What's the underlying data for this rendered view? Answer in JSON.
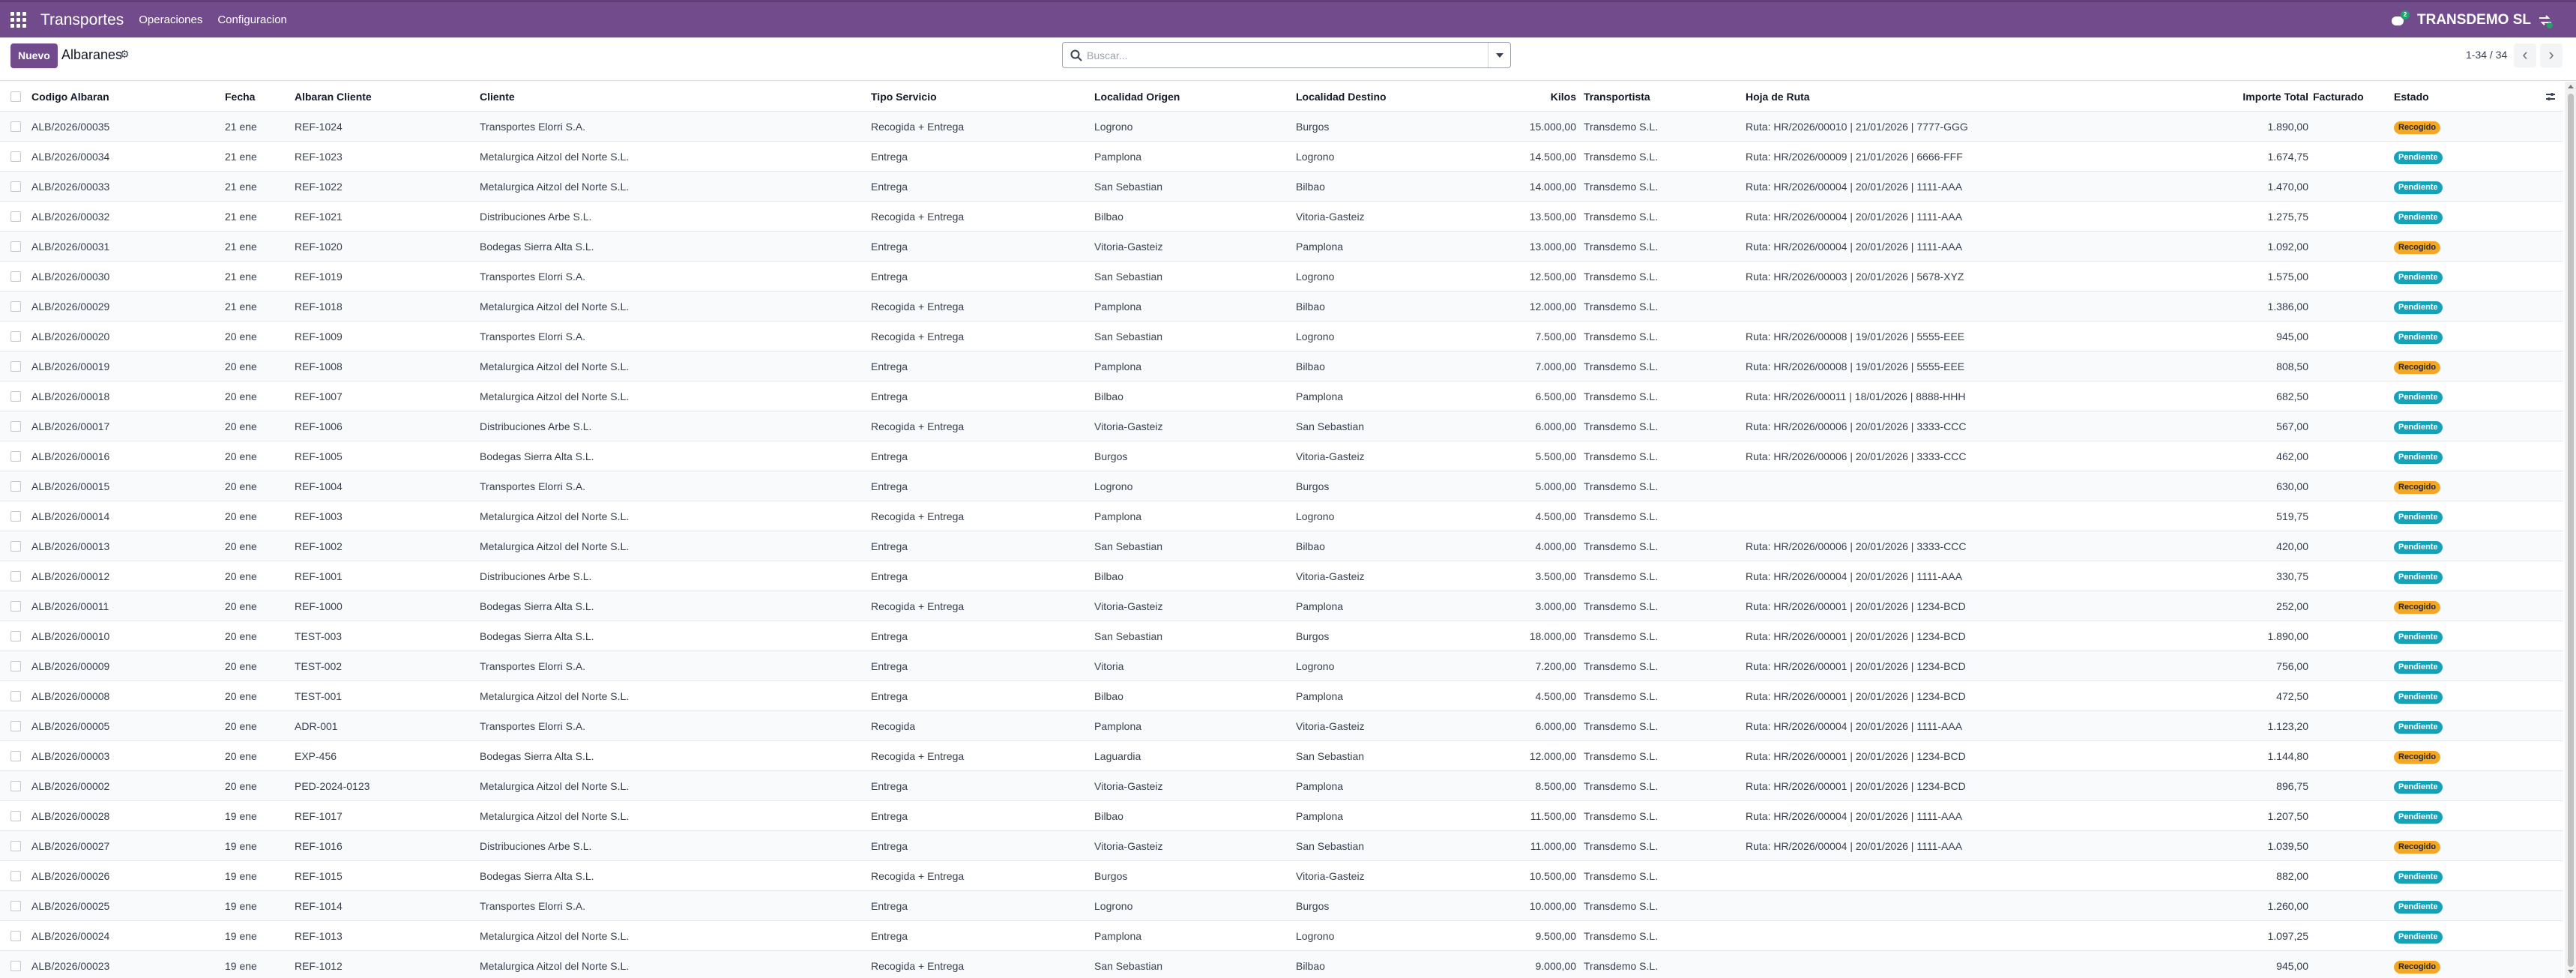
{
  "navbar": {
    "app_title": "Transportes",
    "menu": [
      "Operaciones",
      "Configuracion"
    ],
    "chat_badge": "2",
    "company": "TRANSDEMO SL"
  },
  "control": {
    "new_label": "Nuevo",
    "breadcrumb": "Albaranes",
    "search_placeholder": "Buscar...",
    "pager": "1-34 / 34"
  },
  "columns": [
    "Codigo Albaran",
    "Fecha",
    "Albaran Cliente",
    "Cliente",
    "Tipo Servicio",
    "Localidad Origen",
    "Localidad Destino",
    "Kilos",
    "Transportista",
    "Hoja de Ruta",
    "Importe Total",
    "Facturado",
    "Estado"
  ],
  "rows": [
    [
      "ALB/2026/00035",
      "21 ene",
      "REF-1024",
      "Transportes Elorri S.A.",
      "Recogida + Entrega",
      "Logrono",
      "Burgos",
      "15.000,00",
      "Transdemo S.L.",
      "Ruta: HR/2026/00010 | 21/01/2026 | 7777-GGG",
      "1.890,00",
      "",
      "Recogido"
    ],
    [
      "ALB/2026/00034",
      "21 ene",
      "REF-1023",
      "Metalurgica Aitzol del Norte S.L.",
      "Entrega",
      "Pamplona",
      "Logrono",
      "14.500,00",
      "Transdemo S.L.",
      "Ruta: HR/2026/00009 | 21/01/2026 | 6666-FFF",
      "1.674,75",
      "",
      "Pendiente"
    ],
    [
      "ALB/2026/00033",
      "21 ene",
      "REF-1022",
      "Metalurgica Aitzol del Norte S.L.",
      "Entrega",
      "San Sebastian",
      "Bilbao",
      "14.000,00",
      "Transdemo S.L.",
      "Ruta: HR/2026/00004 | 20/01/2026 | 1111-AAA",
      "1.470,00",
      "",
      "Pendiente"
    ],
    [
      "ALB/2026/00032",
      "21 ene",
      "REF-1021",
      "Distribuciones Arbe S.L.",
      "Recogida + Entrega",
      "Bilbao",
      "Vitoria-Gasteiz",
      "13.500,00",
      "Transdemo S.L.",
      "Ruta: HR/2026/00004 | 20/01/2026 | 1111-AAA",
      "1.275,75",
      "",
      "Pendiente"
    ],
    [
      "ALB/2026/00031",
      "21 ene",
      "REF-1020",
      "Bodegas Sierra Alta S.L.",
      "Entrega",
      "Vitoria-Gasteiz",
      "Pamplona",
      "13.000,00",
      "Transdemo S.L.",
      "Ruta: HR/2026/00004 | 20/01/2026 | 1111-AAA",
      "1.092,00",
      "",
      "Recogido"
    ],
    [
      "ALB/2026/00030",
      "21 ene",
      "REF-1019",
      "Transportes Elorri S.A.",
      "Entrega",
      "San Sebastian",
      "Logrono",
      "12.500,00",
      "Transdemo S.L.",
      "Ruta: HR/2026/00003 | 20/01/2026 | 5678-XYZ",
      "1.575,00",
      "",
      "Pendiente"
    ],
    [
      "ALB/2026/00029",
      "21 ene",
      "REF-1018",
      "Metalurgica Aitzol del Norte S.L.",
      "Recogida + Entrega",
      "Pamplona",
      "Bilbao",
      "12.000,00",
      "Transdemo S.L.",
      "",
      "1.386,00",
      "",
      "Pendiente"
    ],
    [
      "ALB/2026/00020",
      "20 ene",
      "REF-1009",
      "Transportes Elorri S.A.",
      "Recogida + Entrega",
      "San Sebastian",
      "Logrono",
      "7.500,00",
      "Transdemo S.L.",
      "Ruta: HR/2026/00008 | 19/01/2026 | 5555-EEE",
      "945,00",
      "",
      "Pendiente"
    ],
    [
      "ALB/2026/00019",
      "20 ene",
      "REF-1008",
      "Metalurgica Aitzol del Norte S.L.",
      "Entrega",
      "Pamplona",
      "Bilbao",
      "7.000,00",
      "Transdemo S.L.",
      "Ruta: HR/2026/00008 | 19/01/2026 | 5555-EEE",
      "808,50",
      "",
      "Recogido"
    ],
    [
      "ALB/2026/00018",
      "20 ene",
      "REF-1007",
      "Metalurgica Aitzol del Norte S.L.",
      "Entrega",
      "Bilbao",
      "Pamplona",
      "6.500,00",
      "Transdemo S.L.",
      "Ruta: HR/2026/00011 | 18/01/2026 | 8888-HHH",
      "682,50",
      "",
      "Pendiente"
    ],
    [
      "ALB/2026/00017",
      "20 ene",
      "REF-1006",
      "Distribuciones Arbe S.L.",
      "Recogida + Entrega",
      "Vitoria-Gasteiz",
      "San Sebastian",
      "6.000,00",
      "Transdemo S.L.",
      "Ruta: HR/2026/00006 | 20/01/2026 | 3333-CCC",
      "567,00",
      "",
      "Pendiente"
    ],
    [
      "ALB/2026/00016",
      "20 ene",
      "REF-1005",
      "Bodegas Sierra Alta S.L.",
      "Entrega",
      "Burgos",
      "Vitoria-Gasteiz",
      "5.500,00",
      "Transdemo S.L.",
      "Ruta: HR/2026/00006 | 20/01/2026 | 3333-CCC",
      "462,00",
      "",
      "Pendiente"
    ],
    [
      "ALB/2026/00015",
      "20 ene",
      "REF-1004",
      "Transportes Elorri S.A.",
      "Entrega",
      "Logrono",
      "Burgos",
      "5.000,00",
      "Transdemo S.L.",
      "",
      "630,00",
      "",
      "Recogido"
    ],
    [
      "ALB/2026/00014",
      "20 ene",
      "REF-1003",
      "Metalurgica Aitzol del Norte S.L.",
      "Recogida + Entrega",
      "Pamplona",
      "Logrono",
      "4.500,00",
      "Transdemo S.L.",
      "",
      "519,75",
      "",
      "Pendiente"
    ],
    [
      "ALB/2026/00013",
      "20 ene",
      "REF-1002",
      "Metalurgica Aitzol del Norte S.L.",
      "Entrega",
      "San Sebastian",
      "Bilbao",
      "4.000,00",
      "Transdemo S.L.",
      "Ruta: HR/2026/00006 | 20/01/2026 | 3333-CCC",
      "420,00",
      "",
      "Pendiente"
    ],
    [
      "ALB/2026/00012",
      "20 ene",
      "REF-1001",
      "Distribuciones Arbe S.L.",
      "Entrega",
      "Bilbao",
      "Vitoria-Gasteiz",
      "3.500,00",
      "Transdemo S.L.",
      "Ruta: HR/2026/00004 | 20/01/2026 | 1111-AAA",
      "330,75",
      "",
      "Pendiente"
    ],
    [
      "ALB/2026/00011",
      "20 ene",
      "REF-1000",
      "Bodegas Sierra Alta S.L.",
      "Recogida + Entrega",
      "Vitoria-Gasteiz",
      "Pamplona",
      "3.000,00",
      "Transdemo S.L.",
      "Ruta: HR/2026/00001 | 20/01/2026 | 1234-BCD",
      "252,00",
      "",
      "Recogido"
    ],
    [
      "ALB/2026/00010",
      "20 ene",
      "TEST-003",
      "Bodegas Sierra Alta S.L.",
      "Entrega",
      "San Sebastian",
      "Burgos",
      "18.000,00",
      "Transdemo S.L.",
      "Ruta: HR/2026/00001 | 20/01/2026 | 1234-BCD",
      "1.890,00",
      "",
      "Pendiente"
    ],
    [
      "ALB/2026/00009",
      "20 ene",
      "TEST-002",
      "Transportes Elorri S.A.",
      "Entrega",
      "Vitoria",
      "Logrono",
      "7.200,00",
      "Transdemo S.L.",
      "Ruta: HR/2026/00001 | 20/01/2026 | 1234-BCD",
      "756,00",
      "",
      "Pendiente"
    ],
    [
      "ALB/2026/00008",
      "20 ene",
      "TEST-001",
      "Metalurgica Aitzol del Norte S.L.",
      "Entrega",
      "Bilbao",
      "Pamplona",
      "4.500,00",
      "Transdemo S.L.",
      "Ruta: HR/2026/00001 | 20/01/2026 | 1234-BCD",
      "472,50",
      "",
      "Pendiente"
    ],
    [
      "ALB/2026/00005",
      "20 ene",
      "ADR-001",
      "Transportes Elorri S.A.",
      "Recogida",
      "Pamplona",
      "Vitoria-Gasteiz",
      "6.000,00",
      "Transdemo S.L.",
      "Ruta: HR/2026/00004 | 20/01/2026 | 1111-AAA",
      "1.123,20",
      "",
      "Pendiente"
    ],
    [
      "ALB/2026/00003",
      "20 ene",
      "EXP-456",
      "Bodegas Sierra Alta S.L.",
      "Recogida + Entrega",
      "Laguardia",
      "San Sebastian",
      "12.000,00",
      "Transdemo S.L.",
      "Ruta: HR/2026/00001 | 20/01/2026 | 1234-BCD",
      "1.144,80",
      "",
      "Recogido"
    ],
    [
      "ALB/2026/00002",
      "20 ene",
      "PED-2024-0123",
      "Metalurgica Aitzol del Norte S.L.",
      "Entrega",
      "Vitoria-Gasteiz",
      "Pamplona",
      "8.500,00",
      "Transdemo S.L.",
      "Ruta: HR/2026/00001 | 20/01/2026 | 1234-BCD",
      "896,75",
      "",
      "Pendiente"
    ],
    [
      "ALB/2026/00028",
      "19 ene",
      "REF-1017",
      "Metalurgica Aitzol del Norte S.L.",
      "Entrega",
      "Bilbao",
      "Pamplona",
      "11.500,00",
      "Transdemo S.L.",
      "Ruta: HR/2026/00004 | 20/01/2026 | 1111-AAA",
      "1.207,50",
      "",
      "Pendiente"
    ],
    [
      "ALB/2026/00027",
      "19 ene",
      "REF-1016",
      "Distribuciones Arbe S.L.",
      "Entrega",
      "Vitoria-Gasteiz",
      "San Sebastian",
      "11.000,00",
      "Transdemo S.L.",
      "Ruta: HR/2026/00004 | 20/01/2026 | 1111-AAA",
      "1.039,50",
      "",
      "Recogido"
    ],
    [
      "ALB/2026/00026",
      "19 ene",
      "REF-1015",
      "Bodegas Sierra Alta S.L.",
      "Recogida + Entrega",
      "Burgos",
      "Vitoria-Gasteiz",
      "10.500,00",
      "Transdemo S.L.",
      "",
      "882,00",
      "",
      "Pendiente"
    ],
    [
      "ALB/2026/00025",
      "19 ene",
      "REF-1014",
      "Transportes Elorri S.A.",
      "Entrega",
      "Logrono",
      "Burgos",
      "10.000,00",
      "Transdemo S.L.",
      "",
      "1.260,00",
      "",
      "Pendiente"
    ],
    [
      "ALB/2026/00024",
      "19 ene",
      "REF-1013",
      "Metalurgica Aitzol del Norte S.L.",
      "Entrega",
      "Pamplona",
      "Logrono",
      "9.500,00",
      "Transdemo S.L.",
      "",
      "1.097,25",
      "",
      "Pendiente"
    ],
    [
      "ALB/2026/00023",
      "19 ene",
      "REF-1012",
      "Metalurgica Aitzol del Norte S.L.",
      "Recogida + Entrega",
      "San Sebastian",
      "Bilbao",
      "9.000,00",
      "Transdemo S.L.",
      "",
      "945,00",
      "",
      "Recogido"
    ]
  ]
}
